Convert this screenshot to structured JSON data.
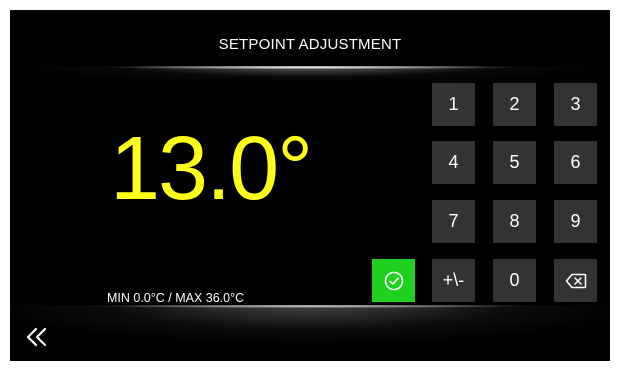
{
  "header": {
    "title": "SETPOINT ADJUSTMENT"
  },
  "display": {
    "value": "13.0°",
    "range_text": "MIN 0.0°C / MAX 36.0°C",
    "value_color": "#ffff1a"
  },
  "keypad": {
    "keys": [
      "1",
      "2",
      "3",
      "4",
      "5",
      "6",
      "7",
      "8",
      "9",
      "+\\-",
      "0"
    ],
    "backspace_icon": "backspace-icon",
    "confirm_icon": "check-circle-icon",
    "confirm_color": "#1fd01f",
    "key_color": "#333333"
  },
  "footer": {
    "back_icon": "double-chevron-left-icon"
  }
}
